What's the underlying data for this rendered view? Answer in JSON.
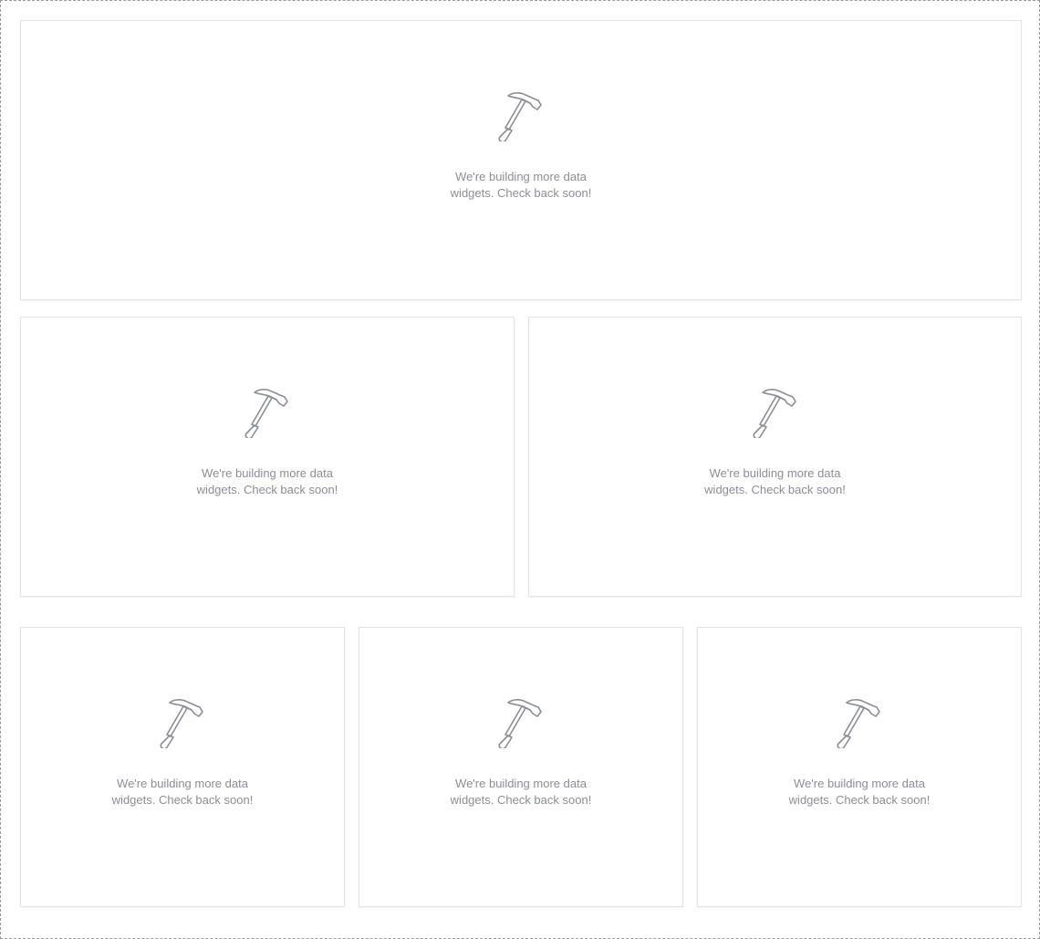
{
  "placeholder": {
    "icon": "hammer-icon",
    "text_color": "#8b8e96"
  },
  "widgets": [
    {
      "message": "We're building more data widgets. Check back soon!"
    },
    {
      "message": "We're building more data widgets. Check back soon!"
    },
    {
      "message": "We're building more data widgets. Check back soon!"
    },
    {
      "message": "We're building more data widgets. Check back soon!"
    },
    {
      "message": "We're building more data widgets. Check back soon!"
    },
    {
      "message": "We're building more data widgets. Check back soon!"
    }
  ]
}
